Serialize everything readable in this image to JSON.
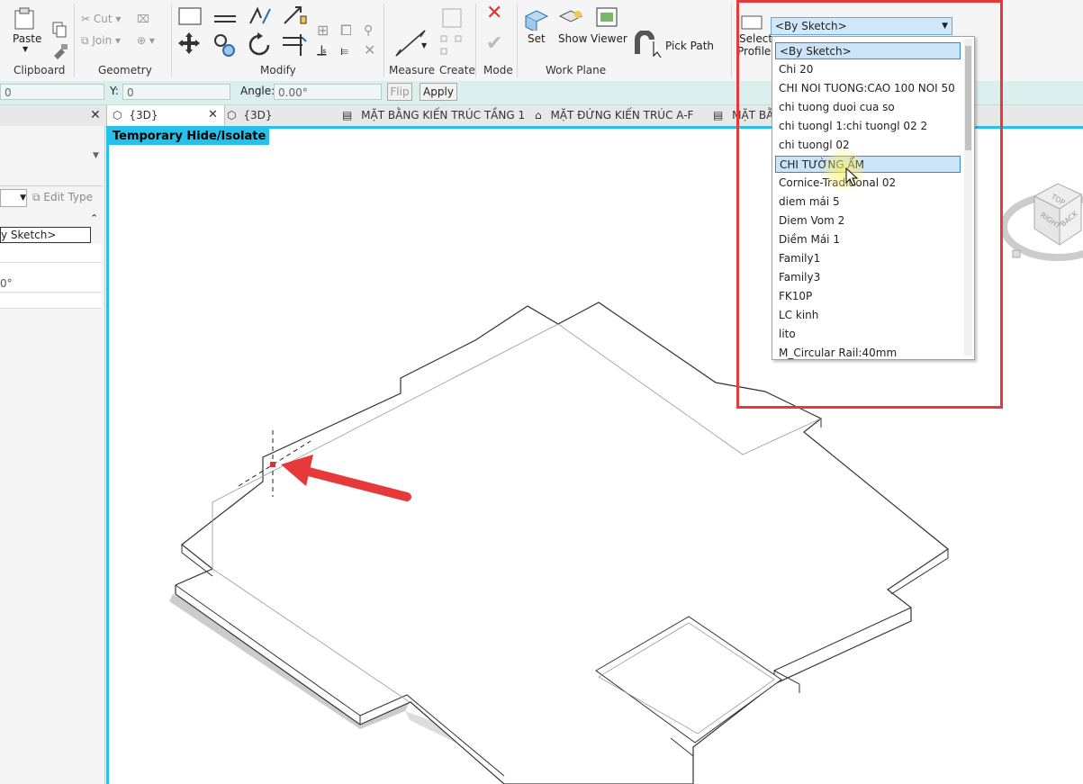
{
  "ribbon": {
    "paste": "Paste",
    "cut": "Cut",
    "join": "Join",
    "panels": {
      "clipboard": "Clipboard",
      "geometry": "Geometry",
      "modify": "Modify",
      "measure": "Measure",
      "create": "Create",
      "mode": "Mode",
      "work_plane": "Work Plane"
    },
    "set": "Set",
    "show": "Show",
    "viewer": "Viewer",
    "pick_path": "Pick Path",
    "select_profile_1": "Select",
    "select_profile_2": "Profile"
  },
  "options_bar": {
    "x_value": "0",
    "y_label": "Y:",
    "y_value": "0",
    "angle_label": "Angle:",
    "angle_value": "0.00°",
    "flip": "Flip",
    "apply": "Apply"
  },
  "tabs": [
    {
      "label": "{3D}"
    },
    {
      "label": "{3D}"
    },
    {
      "label": "MẶT BẰNG KIẾN TRÚC TẦNG 1"
    },
    {
      "label": "MẶT ĐỨNG KIẾN TRÚC A-F"
    },
    {
      "label": "MẶT BẰ"
    }
  ],
  "properties": {
    "edit_type": "Edit Type",
    "profile_value": "y Sketch>",
    "angle_value": "0°"
  },
  "viewport": {
    "isolate_label": "Temporary Hide/Isolate",
    "viewcube": {
      "top": "TOP",
      "right": "RIGHT",
      "back": "BACK"
    }
  },
  "profile_dropdown": {
    "selected": "<By Sketch>",
    "items": [
      "<By Sketch>",
      "Chi 20",
      "CHI NOI TUONG:CAO 100 NOI 50",
      "chi tuong duoi cua so",
      "chi tuongl 1:chi tuongl 02 2",
      "chi tuongl 02",
      "CHI TƯỜNG ẨM",
      "Cornice-Traditional 02",
      "diem mái 5",
      "Diem Vom 2",
      "Diềm Mái 1",
      "Family1",
      "Family3",
      "FK10P",
      "LC kinh",
      "lito",
      "M_Circular Rail:40mm"
    ],
    "highlighted_index": 0,
    "hover_index": 6
  },
  "colors": {
    "accent": "#27c0e8",
    "annotation": "#e5393a",
    "selection": "#cce4f7"
  }
}
